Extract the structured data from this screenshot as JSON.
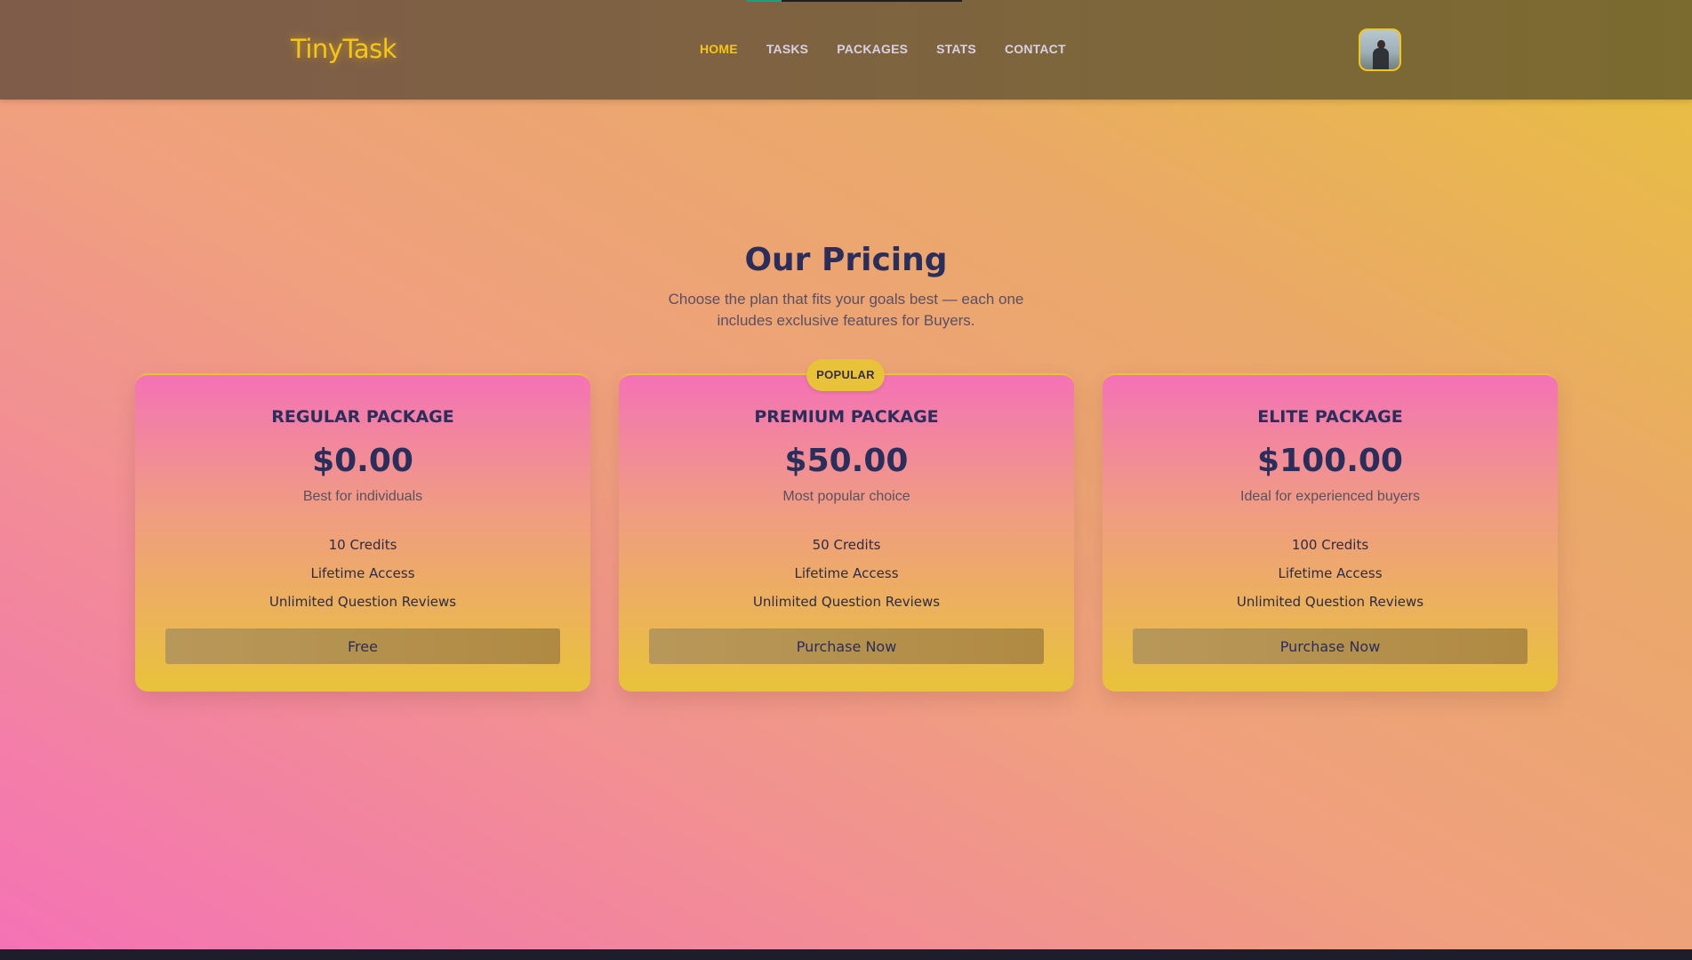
{
  "header": {
    "logo": "TinyTask",
    "nav": [
      "HOME",
      "TASKS",
      "PACKAGES",
      "STATS",
      "CONTACT"
    ],
    "active_nav": "HOME",
    "progress_fraction": 0.16
  },
  "pricing": {
    "title": "Our Pricing",
    "subtitle": "Choose the plan that fits your goals best — each one includes exclusive features for Buyers.",
    "plans": [
      {
        "name": "REGULAR PACKAGE",
        "price": "$0.00",
        "tagline": "Best for individuals",
        "features": [
          "10 Credits",
          "Lifetime Access",
          "Unlimited Question Reviews"
        ],
        "button": "Free"
      },
      {
        "badge": "POPULAR",
        "name": "PREMIUM PACKAGE",
        "price": "$50.00",
        "tagline": "Most popular choice",
        "features": [
          "50 Credits",
          "Lifetime Access",
          "Unlimited Question Reviews"
        ],
        "button": "Purchase Now"
      },
      {
        "name": "ELITE PACKAGE",
        "price": "$100.00",
        "tagline": "Ideal for experienced buyers",
        "features": [
          "100 Credits",
          "Lifetime Access",
          "Unlimited Question Reviews"
        ],
        "button": "Purchase Now"
      }
    ]
  },
  "colors": {
    "accent": "#f5c518",
    "heading": "#2b2d5a",
    "navbar": "#7e6340"
  }
}
